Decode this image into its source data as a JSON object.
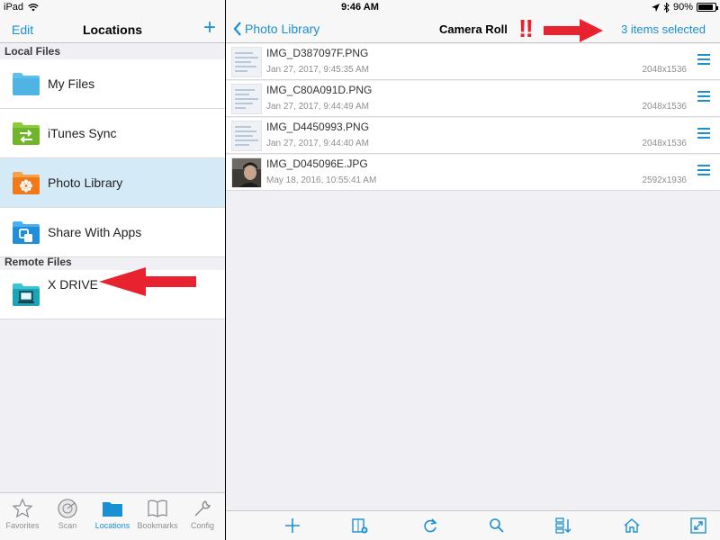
{
  "status_bar": {
    "device": "iPad",
    "time": "9:46 AM",
    "battery": "90%",
    "battery_level": 0.9
  },
  "left_pane": {
    "edit_label": "Edit",
    "title": "Locations",
    "add_label": "+",
    "sections": {
      "local": "Local Files",
      "remote": "Remote Files"
    },
    "local_items": [
      {
        "label": "My Files",
        "icon": "folder-icon",
        "color": "#5bc0eb"
      },
      {
        "label": "iTunes Sync",
        "icon": "sync-arrows-icon",
        "color": "#7bbd2e"
      },
      {
        "label": "Photo Library",
        "icon": "photo-flower-icon",
        "color": "#f58220",
        "selected": true
      },
      {
        "label": "Share With Apps",
        "icon": "share-apps-icon",
        "color": "#2c9ee8"
      }
    ],
    "remote_items": [
      {
        "label": "X DRIVE",
        "icon": "monitor-icon",
        "color": "#26b3c8"
      }
    ]
  },
  "tab_bar": [
    {
      "label": "Favorites",
      "icon": "star-icon"
    },
    {
      "label": "Scan",
      "icon": "radar-icon"
    },
    {
      "label": "Locations",
      "icon": "folder-icon",
      "active": true
    },
    {
      "label": "Bookmarks",
      "icon": "book-icon"
    },
    {
      "label": "Config",
      "icon": "wrench-icon"
    }
  ],
  "right_pane": {
    "back_label": "Photo Library",
    "title": "Camera Roll",
    "selection_label": "3 items selected",
    "files": [
      {
        "name": "IMG_D387097F.PNG",
        "date": "Jan 27, 2017, 9:45:35 AM",
        "dimensions": "2048x1536",
        "thumb": "screenshot"
      },
      {
        "name": "IMG_C80A091D.PNG",
        "date": "Jan 27, 2017, 9:44:49 AM",
        "dimensions": "2048x1536",
        "thumb": "screenshot"
      },
      {
        "name": "IMG_D4450993.PNG",
        "date": "Jan 27, 2017, 9:44:40 AM",
        "dimensions": "2048x1536",
        "thumb": "screenshot"
      },
      {
        "name": "IMG_D045096E.JPG",
        "date": "May 18, 2016, 10:55:41 AM",
        "dimensions": "2592x1936",
        "thumb": "photo"
      }
    ],
    "toolbar": [
      "add-icon",
      "new-folder-icon",
      "refresh-icon",
      "search-icon",
      "sort-icon",
      "home-icon",
      "fullscreen-icon"
    ]
  },
  "annotations": {
    "exclamations": "‼",
    "arrow_color": "#e8232f"
  },
  "colors": {
    "accent": "#1a8fd1",
    "selected_row": "#d4eaf7"
  }
}
